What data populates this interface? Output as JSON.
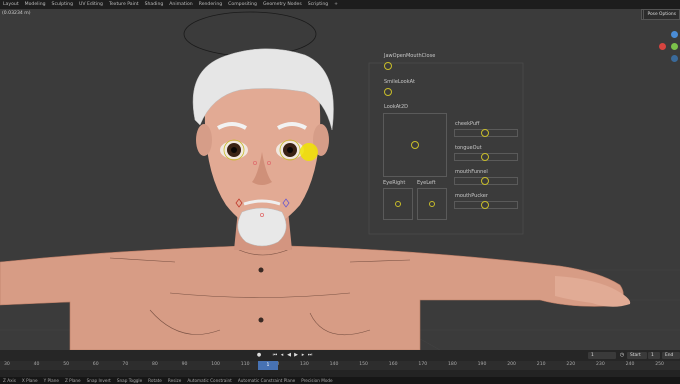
{
  "workspaces": [
    "Layout",
    "Modeling",
    "Sculpting",
    "UV Editing",
    "Texture Paint",
    "Shading",
    "Animation",
    "Rendering",
    "Compositing",
    "Geometry Nodes",
    "Scripting",
    "+"
  ],
  "viewport": {
    "corner_label": "(0.03234 m)",
    "pose_options": "Pose Options",
    "axis_colors": {
      "x": "#d6443f",
      "y": "#7bc14a",
      "z": "#4a8cd6"
    }
  },
  "face_controls": {
    "jaw_mouth_close": "JawOpenMouthClose",
    "smile_look_at": "SmileLookAt",
    "look_at_2d": "LookAt2D",
    "eye_right": "EyeRight",
    "eye_left": "EyeLeft",
    "cheek_puff": "cheekPuff",
    "tongue_out": "tongueOut",
    "mouth_funnel": "mouthFunnel",
    "mouth_pucker": "mouthPucker"
  },
  "timeline": {
    "current_frame": "1",
    "start_label": "Start",
    "start_value": "1",
    "end_label": "End",
    "end_value": "250",
    "ruler_ticks": [
      "30",
      "40",
      "50",
      "60",
      "70",
      "80",
      "90",
      "100",
      "110",
      "120",
      "130",
      "140",
      "150",
      "160",
      "170",
      "180",
      "190",
      "200",
      "210",
      "220",
      "230",
      "240",
      "250"
    ],
    "playhead_frame": "1"
  },
  "statusbar": [
    "Z Axis",
    "X Plane",
    "Y Plane",
    "Z Plane",
    "Snap Invert",
    "Snap Toggle",
    "Rotate",
    "Resize",
    "Automatic Constraint",
    "Automatic Constraint Plane",
    "Precision Mode"
  ],
  "colors": {
    "accent": "#4772b3",
    "control_ring": "#c8bd2a",
    "skin": "#d79c85"
  }
}
